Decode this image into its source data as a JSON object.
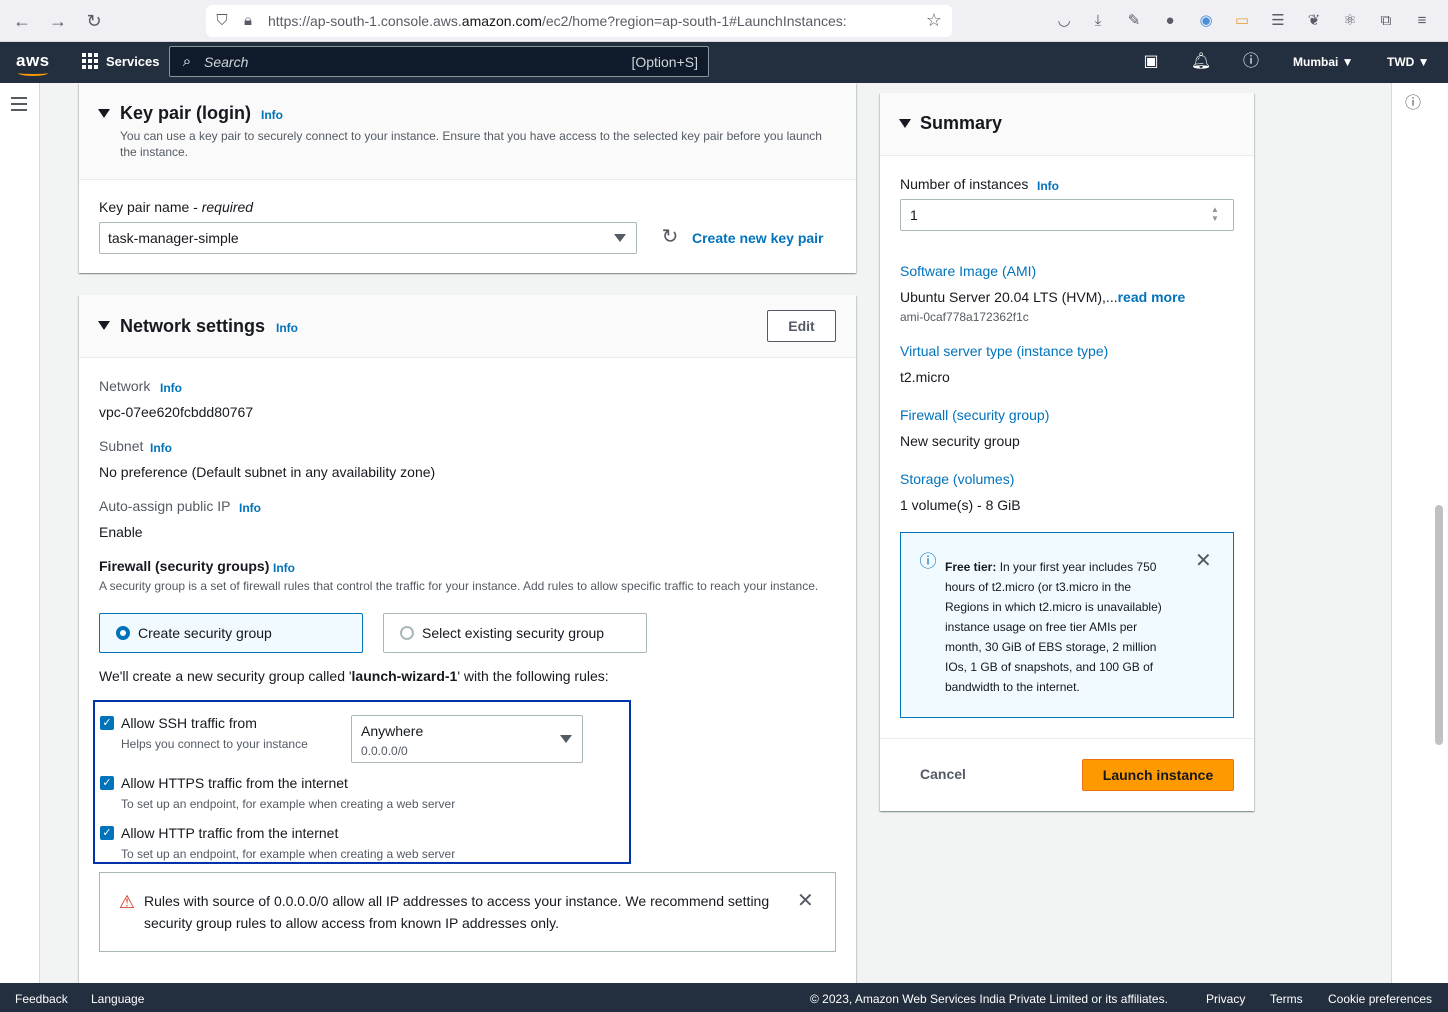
{
  "browser": {
    "url_prefix": "https://ap-south-1.console.aws.",
    "url_domain": "amazon.com",
    "url_suffix": "/ec2/home?region=ap-south-1#LaunchInstances:"
  },
  "header": {
    "logo": "aws",
    "services": "Services",
    "search_placeholder": "Search",
    "search_shortcut": "[Option+S]",
    "region": "Mumbai ▼",
    "account": "TWD ▼"
  },
  "keypair": {
    "title": "Key pair (login)",
    "info": "Info",
    "description": "You can use a key pair to securely connect to your instance. Ensure that you have access to the selected key pair before you launch the instance.",
    "field_label": "Key pair name - ",
    "field_required": "required",
    "selected": "task-manager-simple",
    "create_link": "Create new key pair"
  },
  "network": {
    "title": "Network settings",
    "info": "Info",
    "edit": "Edit",
    "network_label": "Network",
    "network_value": "vpc-07ee620fcbdd80767",
    "subnet_label": "Subnet",
    "subnet_value": "No preference (Default subnet in any availability zone)",
    "public_ip_label": "Auto-assign public IP",
    "public_ip_value": "Enable",
    "firewall_label": "Firewall (security groups)",
    "firewall_desc": "A security group is a set of firewall rules that control the traffic for your instance. Add rules to allow specific traffic to reach your instance.",
    "option_create": "Create security group",
    "option_existing": "Select existing security group",
    "sg_intro_pre": "We'll create a new security group called '",
    "sg_name": "launch-wizard-1",
    "sg_intro_post": "' with the following rules:",
    "rules": [
      {
        "label": "Allow SSH traffic from",
        "desc": "Helps you connect to your instance"
      },
      {
        "label": "Allow HTTPS traffic from the internet",
        "desc": "To set up an endpoint, for example when creating a web server"
      },
      {
        "label": "Allow HTTP traffic from the internet",
        "desc": "To set up an endpoint, for example when creating a web server"
      }
    ],
    "ssh_source": "Anywhere",
    "ssh_cidr": "0.0.0.0/0",
    "warning": "Rules with source of 0.0.0.0/0 allow all IP addresses to access your instance. We recommend setting security group rules to allow access from known IP addresses only."
  },
  "summary": {
    "title": "Summary",
    "instances_label": "Number of instances",
    "info": "Info",
    "instances_value": "1",
    "ami_label": "Software Image (AMI)",
    "ami_value": "Ubuntu Server 20.04 LTS (HVM),...",
    "ami_readmore": "read more",
    "ami_id": "ami-0caf778a172362f1c",
    "type_label": "Virtual server type (instance type)",
    "type_value": "t2.micro",
    "firewall_label": "Firewall (security group)",
    "firewall_value": "New security group",
    "storage_label": "Storage (volumes)",
    "storage_value": "1 volume(s) - 8 GiB",
    "free_tier_title": "Free tier:",
    "free_tier_text": " In your first year includes 750 hours of t2.micro (or t3.micro in the Regions in which t2.micro is unavailable) instance usage on free tier AMIs per month, 30 GiB of EBS storage, 2 million IOs, 1 GB of snapshots, and 100 GB of bandwidth to the internet.",
    "cancel": "Cancel",
    "launch": "Launch instance"
  },
  "footer": {
    "feedback": "Feedback",
    "language": "Language",
    "copyright": "© 2023, Amazon Web Services India Private Limited or its affiliates.",
    "privacy": "Privacy",
    "terms": "Terms",
    "cookies": "Cookie preferences"
  }
}
